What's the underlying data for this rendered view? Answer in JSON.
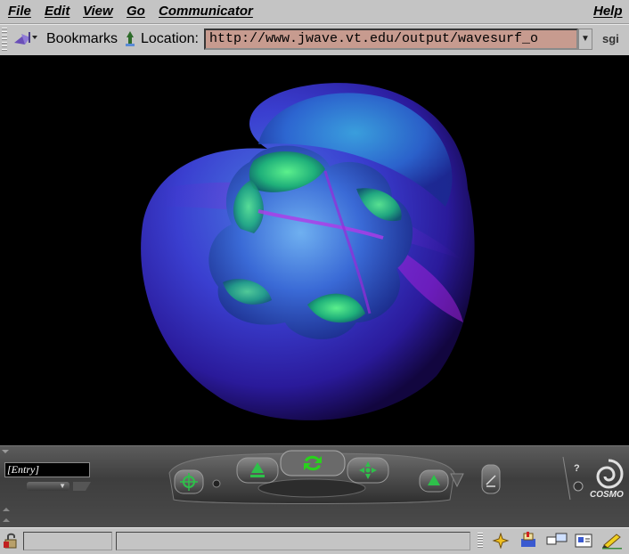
{
  "menu": {
    "file": "File",
    "edit": "Edit",
    "view": "View",
    "go": "Go",
    "communicator": "Communicator",
    "help": "Help"
  },
  "toolbar": {
    "bookmarks_label": "Bookmarks",
    "location_label": "Location:",
    "url_value": "http://www.jwave.vt.edu/output/wavesurf_o",
    "brand": "sgi"
  },
  "icons": {
    "bookmarks": "bookmarks-icon",
    "location": "location-icon",
    "url_dropdown": "chevron-down-icon",
    "security": "lock-icon"
  },
  "viewer": {
    "entry_value": "[Entry]",
    "brand": "COSMO"
  },
  "colors": {
    "chrome": "#c4c4c4",
    "url_field": "#c79b8f",
    "viewport": "#000000",
    "panel": "#4a4a4a",
    "nav_accent": "#29d11c"
  }
}
